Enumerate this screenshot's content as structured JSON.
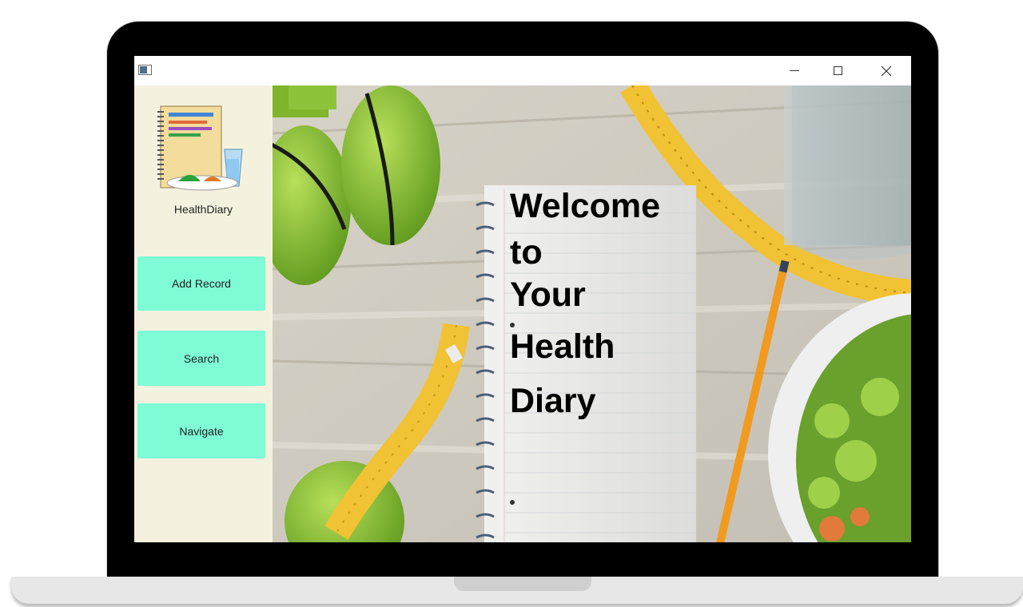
{
  "window": {
    "minimize_label": "—",
    "maximize_label": "☐",
    "close_label": "✕"
  },
  "sidebar": {
    "app_name": "HealthDiary",
    "buttons": [
      {
        "label": "Add Record"
      },
      {
        "label": "Search"
      },
      {
        "label": "Navigate"
      }
    ]
  },
  "hero": {
    "lines": [
      "Welcome",
      "to",
      "Your",
      "Health",
      "Diary"
    ]
  },
  "colors": {
    "sidebar_bg": "#f4f2de",
    "button_bg": "#7ffcd6",
    "frame": "#000000"
  },
  "icons": {
    "app": "app-window-icon",
    "logo": "diary-notebook-icon"
  }
}
